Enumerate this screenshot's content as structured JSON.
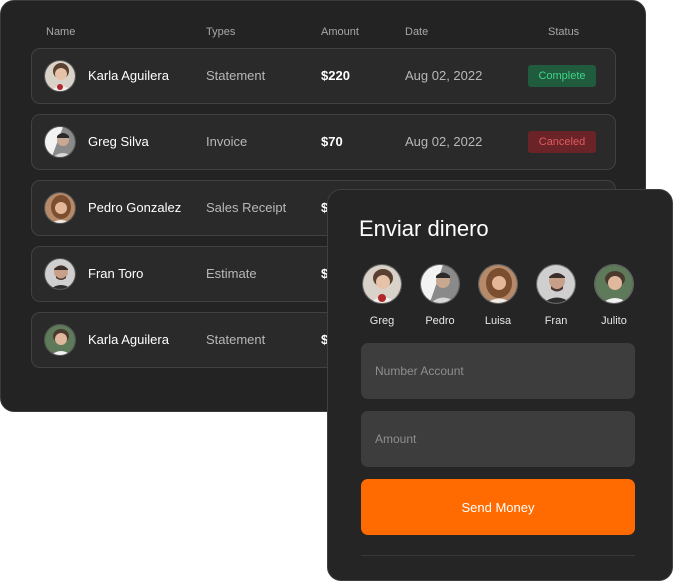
{
  "transactions": {
    "headers": {
      "name": "Name",
      "types": "Types",
      "amount": "Amount",
      "date": "Date",
      "status": "Status"
    },
    "rows": [
      {
        "name": "Karla Aguilera",
        "type": "Statement",
        "amount": "$220",
        "date": "Aug 02, 2022",
        "status": "Complete",
        "status_kind": "complete",
        "avatar": "person-karla-icon"
      },
      {
        "name": "Greg Silva",
        "type": "Invoice",
        "amount": "$70",
        "date": "Aug 02, 2022",
        "status": "Canceled",
        "status_kind": "canceled",
        "avatar": "person-greg-icon"
      },
      {
        "name": "Pedro Gonzalez",
        "type": "Sales Receipt",
        "amount": "$",
        "avatar": "person-pedro-icon"
      },
      {
        "name": "Fran Toro",
        "type": "Estimate",
        "amount": "$",
        "avatar": "person-fran-icon"
      },
      {
        "name": "Karla Aguilera",
        "type": "Statement",
        "amount": "$",
        "avatar": "person-karla-icon"
      }
    ]
  },
  "send": {
    "title": "Enviar dinero",
    "contacts": [
      {
        "label": "Greg",
        "avatar": "person-greg-icon"
      },
      {
        "label": "Pedro",
        "avatar": "person-pedro-icon"
      },
      {
        "label": "Luisa",
        "avatar": "person-luisa-icon"
      },
      {
        "label": "Fran",
        "avatar": "person-fran-icon"
      },
      {
        "label": "Julito",
        "avatar": "person-julito-icon"
      }
    ],
    "account_placeholder": "Number Account",
    "amount_placeholder": "Amount",
    "button_label": "Send Money"
  },
  "colors": {
    "accent": "#ff6b00",
    "panel": "#232323",
    "complete_bg": "#1f5b3c",
    "complete_text": "#3fd58a",
    "canceled_bg": "#6a2428",
    "canceled_text": "#e2595e"
  }
}
